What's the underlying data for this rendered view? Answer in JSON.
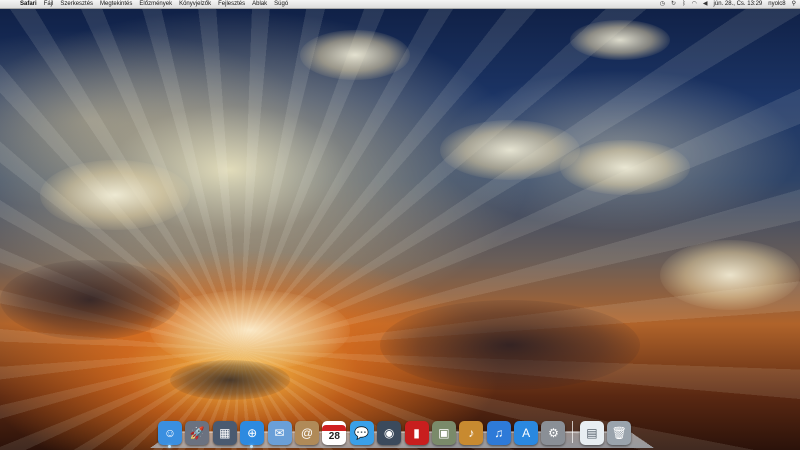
{
  "menubar": {
    "apple_icon": "apple-logo",
    "app_name": "Safari",
    "menus": [
      "Fájl",
      "Szerkesztés",
      "Megtekintés",
      "Előzmények",
      "Könyvjelzők",
      "Fejlesztés",
      "Ablak",
      "Súgó"
    ],
    "status_icons": [
      "time-machine-icon",
      "sync-icon",
      "bluetooth-icon",
      "wifi-icon",
      "volume-icon"
    ],
    "datetime": "jún. 28., Cs. 13:29",
    "user": "nyolc8",
    "spotlight_icon": "spotlight-icon"
  },
  "dock": {
    "apps": [
      {
        "name": "finder",
        "glyph": "☺",
        "color": "#3a8fe0",
        "running": true
      },
      {
        "name": "launchpad",
        "glyph": "🚀",
        "color": "#6b7280",
        "running": false
      },
      {
        "name": "mission-control",
        "glyph": "▦",
        "color": "#4a5a70",
        "running": false
      },
      {
        "name": "safari",
        "glyph": "⊕",
        "color": "#2d8ae0",
        "running": true
      },
      {
        "name": "mail",
        "glyph": "✉",
        "color": "#6a9fd8",
        "running": false
      },
      {
        "name": "contacts",
        "glyph": "@",
        "color": "#b08a58",
        "running": false
      },
      {
        "name": "calendar",
        "glyph": "28",
        "color": "#ffffff",
        "running": false
      },
      {
        "name": "messages",
        "glyph": "💬",
        "color": "#3aa0e8",
        "running": false
      },
      {
        "name": "facetime",
        "glyph": "◉",
        "color": "#3b4a5c",
        "running": false
      },
      {
        "name": "photo-booth",
        "glyph": "▮",
        "color": "#c81e1e",
        "running": false
      },
      {
        "name": "iphoto",
        "glyph": "▣",
        "color": "#7a8a6a",
        "running": false
      },
      {
        "name": "garageband",
        "glyph": "♪",
        "color": "#c88a30",
        "running": false
      },
      {
        "name": "itunes",
        "glyph": "♫",
        "color": "#2e7ad8",
        "running": false
      },
      {
        "name": "app-store",
        "glyph": "A",
        "color": "#2a88e0",
        "running": false
      },
      {
        "name": "system-preferences",
        "glyph": "⚙",
        "color": "#8a8f96",
        "running": false
      }
    ],
    "stacks": [
      {
        "name": "documents",
        "glyph": "▤",
        "color": "#e8eef2",
        "running": false
      },
      {
        "name": "trash",
        "glyph": "🗑",
        "color": "#9aa3ac",
        "running": false
      }
    ]
  }
}
